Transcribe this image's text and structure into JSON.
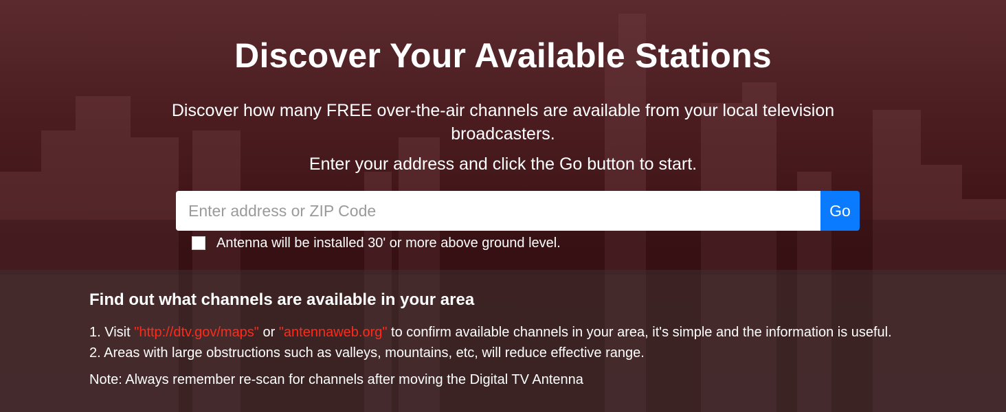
{
  "hero": {
    "title": "Discover Your Available Stations",
    "subtitle": "Discover how many FREE over-the-air channels are available from your local television broadcasters.",
    "instruction": "Enter your address and click the Go button to start."
  },
  "search": {
    "placeholder": "Enter address or ZIP Code",
    "value": "",
    "go_label": "Go"
  },
  "antenna_option": {
    "label": "Antenna will be installed 30' or more above ground level.",
    "checked": false
  },
  "info": {
    "heading": "Find out what channels are available in your area",
    "line1": {
      "prefix": "1. Visit ",
      "link1": "\"http://dtv.gov/maps\"",
      "middle": " or ",
      "link2": "\"antennaweb.org\"",
      "suffix": " to confirm available channels in your area, it's simple and the information is useful."
    },
    "line2": "2. Areas with large obstructions such as valleys, mountains, etc, will reduce effective range.",
    "note": "Note: Always remember re-scan for channels after moving the Digital TV Antenna"
  },
  "colors": {
    "accent": "#0a7bff",
    "link": "#ff2a1a",
    "background": "#4a1f22"
  }
}
